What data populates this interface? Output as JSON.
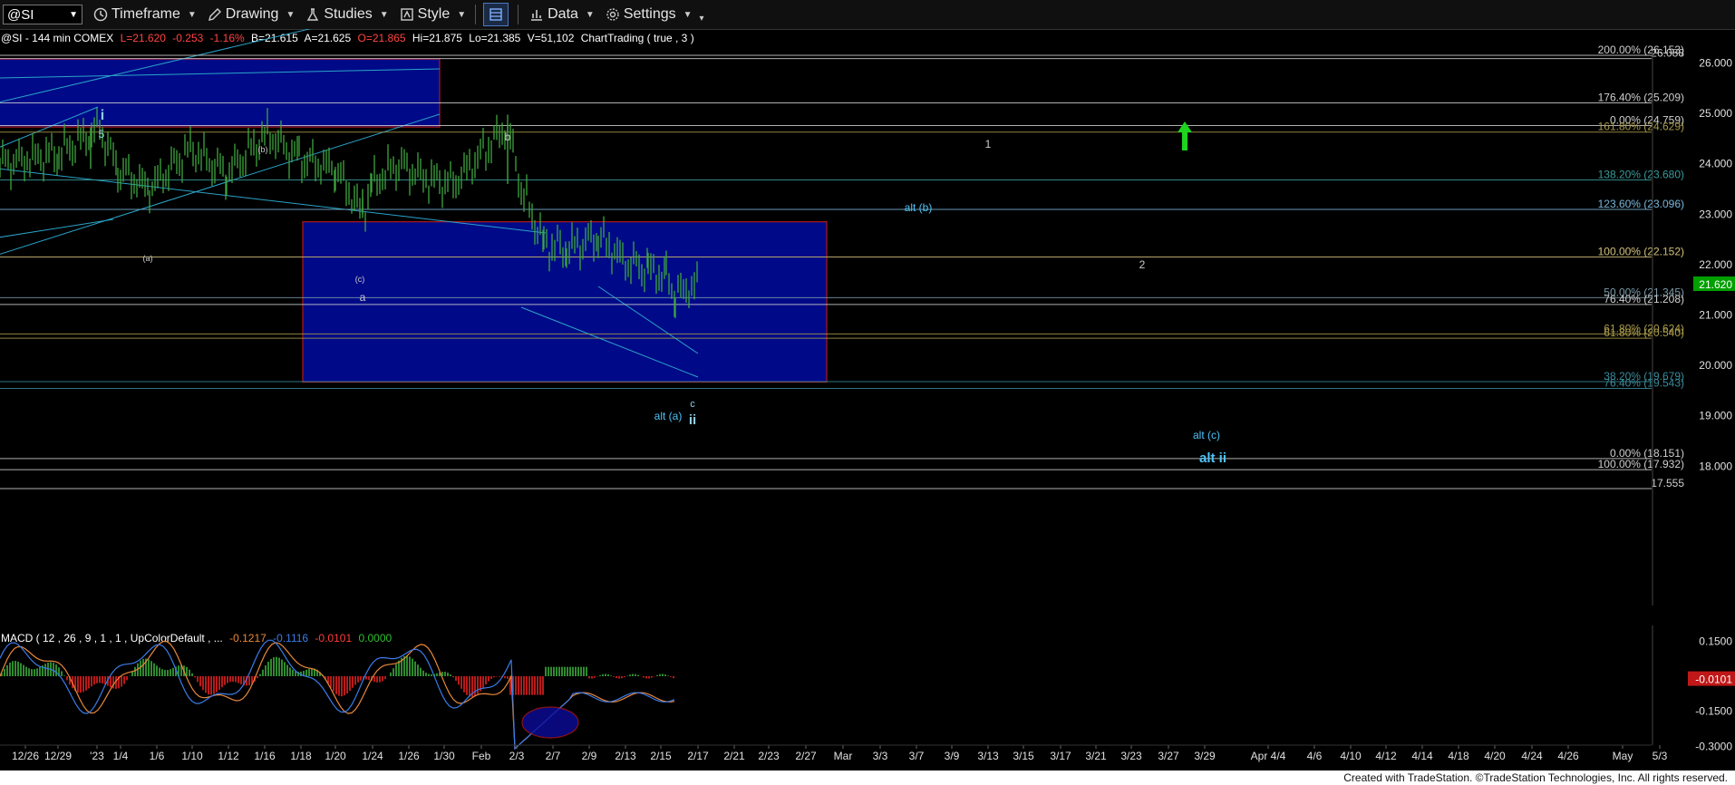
{
  "toolbar": {
    "symbol": "@SI",
    "timeframe_label": "Timeframe",
    "drawing_label": "Drawing",
    "studies_label": "Studies",
    "style_label": "Style",
    "data_label": "Data",
    "settings_label": "Settings"
  },
  "status_line": {
    "symbol_info": "@SI - 144 min  COMEX",
    "last": "L=21.620",
    "change": "-0.253",
    "change_pct": "-1.16%",
    "bid": "B=21.615",
    "ask": "A=21.625",
    "open": "O=21.865",
    "high": "Hi=21.875",
    "low": "Lo=21.385",
    "volume": "V=51,102",
    "study": "ChartTrading ( true , 3 )"
  },
  "macd_label": {
    "params": "MACD ( 12 , 26 , 9 , 1 , 1 , UpColorDefault , ...",
    "v1": "-0.1217",
    "v2": "-0.1116",
    "v3": "-0.0101",
    "v4": "0.0000"
  },
  "colors": {
    "background": "#000000",
    "price_bars": "#3fa53f",
    "box_fill": "#000a88",
    "box_border_top": "#b01818",
    "trendline": "#2aa3c8",
    "last_price_tag": "#00a000",
    "macd_line": "#e8883a",
    "signal_line": "#3a7ce8",
    "hist_up": "#2f8a2f",
    "hist_down": "#b81a1a"
  },
  "chart_data": {
    "type": "line",
    "title": "@SI - 144 min COMEX",
    "xlabel": "",
    "ylabel": "",
    "ylim": [
      17.4,
      26.3
    ],
    "price_axis_ticks": [
      "26.000",
      "25.000",
      "24.000",
      "23.000",
      "22.000",
      "21.000",
      "20.000",
      "19.000",
      "18.000"
    ],
    "date_ticks": [
      "12/26",
      "12/29",
      "'23",
      "1/4",
      "1/6",
      "1/10",
      "1/12",
      "1/16",
      "1/18",
      "1/20",
      "1/24",
      "1/26",
      "1/30",
      "Feb",
      "2/3",
      "2/7",
      "2/9",
      "2/13",
      "2/15",
      "2/17",
      "2/21",
      "2/23",
      "2/27",
      "Mar",
      "3/3",
      "3/7",
      "3/9",
      "3/13",
      "3/15",
      "3/17",
      "3/21",
      "3/23",
      "3/27",
      "3/29",
      "Apr 4/4",
      "4/6",
      "4/10",
      "4/12",
      "4/14",
      "4/18",
      "4/20",
      "4/24",
      "4/26",
      "May",
      "5/3"
    ],
    "last_price": 21.62,
    "series": [
      {
        "name": "@SI",
        "x": [
          "12/26",
          "12/29",
          "1/3",
          "1/4",
          "1/6",
          "1/10",
          "1/12",
          "1/16",
          "1/18",
          "1/20",
          "1/23",
          "1/24",
          "1/26",
          "1/30",
          "2/1",
          "2/2",
          "2/3",
          "2/6",
          "2/7",
          "2/9",
          "2/10",
          "2/13",
          "2/14",
          "2/15",
          "2/16"
        ],
        "values": [
          24.0,
          24.2,
          24.7,
          23.9,
          23.5,
          24.3,
          23.8,
          24.6,
          24.1,
          23.9,
          23.0,
          23.6,
          24.0,
          23.7,
          23.6,
          24.75,
          23.5,
          22.4,
          22.3,
          22.55,
          22.05,
          21.9,
          21.75,
          21.4,
          21.62
        ]
      }
    ],
    "horizontal_levels": [
      {
        "label": "200.00% (26.153)",
        "value": 26.153
      },
      {
        "label": "26.088",
        "value": 26.088
      },
      {
        "label": "176.40% (25.209)",
        "value": 25.209
      },
      {
        "label": "0.00% (24.759)",
        "value": 24.759
      },
      {
        "label": "161.80% (24.629)",
        "value": 24.629
      },
      {
        "label": "138.20% (23.680)",
        "value": 23.68
      },
      {
        "label": "123.60% (23.096)",
        "value": 23.096
      },
      {
        "label": "123.60% (23.096)",
        "value": 23.096
      },
      {
        "label": "100.00% (22.152)",
        "value": 22.152
      },
      {
        "label": "100.00% (22.152)",
        "value": 22.152
      },
      {
        "label": "50.00% (21.345)",
        "value": 21.345
      },
      {
        "label": "76.40% (21.208)",
        "value": 21.208
      },
      {
        "label": "61.80% (20.624)",
        "value": 20.624
      },
      {
        "label": "61.80% (20.540)",
        "value": 20.54
      },
      {
        "label": "38.20% (19.679)",
        "value": 19.679
      },
      {
        "label": "76.40% (19.543)",
        "value": 19.543
      },
      {
        "label": "0.00% (18.151)",
        "value": 18.151
      },
      {
        "label": "100.00% (17.932)",
        "value": 17.932
      },
      {
        "label": "17.555",
        "value": 17.555
      }
    ],
    "wave_labels": [
      "i",
      "5",
      "(b)",
      "(a)",
      "(c)",
      "a",
      "b",
      "c",
      "ii",
      "alt (a)",
      "alt (b)",
      "alt (c)",
      "alt ii",
      "1",
      "2"
    ],
    "macd_axis_ticks": [
      "0.1500",
      "-0.1500",
      "-0.3000"
    ],
    "macd_last": "-0.0101"
  },
  "footer": {
    "credit": "Created with TradeStation. ©TradeStation Technologies, Inc. All rights reserved."
  }
}
